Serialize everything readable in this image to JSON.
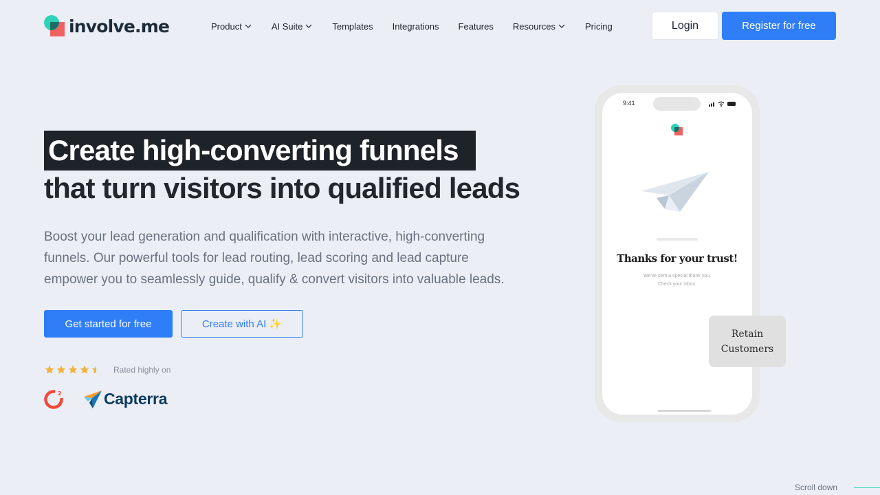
{
  "header": {
    "logo_text": "involve.me",
    "nav": [
      {
        "label": "Product",
        "dropdown": true
      },
      {
        "label": "AI Suite",
        "dropdown": true
      },
      {
        "label": "Templates",
        "dropdown": false
      },
      {
        "label": "Integrations",
        "dropdown": false
      },
      {
        "label": "Features",
        "dropdown": false
      },
      {
        "label": "Resources",
        "dropdown": true
      },
      {
        "label": "Pricing",
        "dropdown": false
      }
    ],
    "login_label": "Login",
    "register_label": "Register for free"
  },
  "hero": {
    "title_line1": "Create high-converting funnels",
    "title_line2": "that turn visitors into qualified leads",
    "description": "Boost your lead generation and qualification with interactive, high-converting funnels. Our powerful tools for lead routing, lead scoring and lead capture empower you to seamlessly guide, qualify & convert visitors into valuable leads.",
    "primary_cta": "Get started for free",
    "secondary_cta": "Create with AI ✨",
    "rating_stars": 4.5,
    "rated_text": "Rated highly on",
    "capterra_text": "Capterra",
    "g2_text": "2"
  },
  "phone": {
    "time": "9:41",
    "thanks_title": "Thanks for your trust!",
    "thanks_line1": "We've sent a special thank you.",
    "thanks_line2": "Check your inbox.",
    "badge_line1": "Retain",
    "badge_line2": "Customers"
  },
  "footer": {
    "scroll_label": "Scroll down"
  },
  "colors": {
    "background": "#ebeef4",
    "accent_blue": "#2f7ef7",
    "brand_teal": "#2ed3b7",
    "brand_red": "#f0615f",
    "star_yellow": "#f2b33d",
    "headline_dark": "#1e2329"
  },
  "icons": {
    "nav_dropdown": "chevron-down-icon",
    "rating": "star-icon",
    "ai_button": "sparkles-icon"
  }
}
